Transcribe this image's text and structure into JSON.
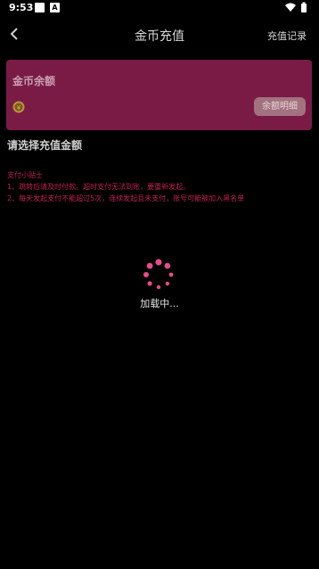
{
  "status_bar": {
    "time": "9:53",
    "icon2_label": "A"
  },
  "nav": {
    "title": "金币充值",
    "record_link": "充值记录"
  },
  "balance": {
    "title": "金币余额",
    "detail_button": "余额明细"
  },
  "section": {
    "title": "请选择充值金额"
  },
  "tips": {
    "heading": "支付小贴士",
    "line1": "1、跳转后请及时付款。超时支付无法到账，要重新发起。",
    "line2": "2、每天发起支付不能超过5次，连续发起且未支付，账号可能被加入黑名单"
  },
  "loading": {
    "text": "加载中..."
  },
  "colors": {
    "background": "#000000",
    "card": "#7a1b46",
    "accent": "#e84a8a",
    "tip_text": "#c21f55"
  }
}
